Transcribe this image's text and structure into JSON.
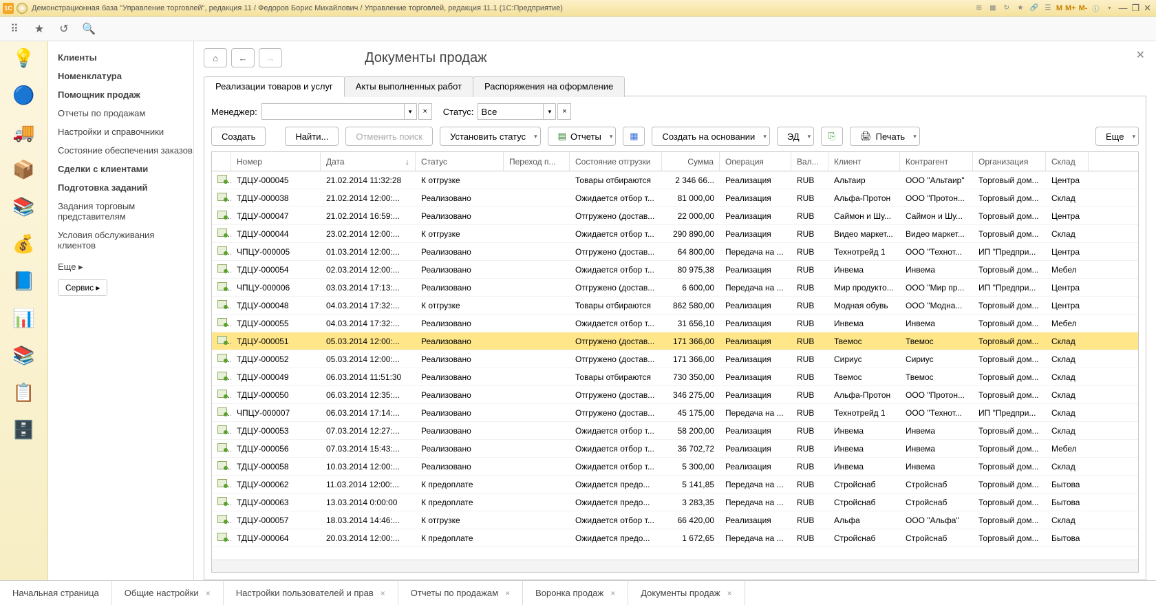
{
  "window_title": "Демонстрационная база \"Управление торговлей\", редакция 11 / Федоров Борис Михайлович / Управление торговлей, редакция 11.1  (1С:Предприятие)",
  "m_buttons": [
    "M",
    "M+",
    "M-"
  ],
  "nav": {
    "items": [
      {
        "label": "Клиенты",
        "bold": true
      },
      {
        "label": "Номенклатура",
        "bold": true
      },
      {
        "label": "Помощник продаж",
        "bold": true
      },
      {
        "label": "Отчеты по продажам",
        "bold": false
      },
      {
        "label": "Настройки и справочники",
        "bold": false
      },
      {
        "label": "Состояние обеспечения заказов",
        "bold": false
      },
      {
        "label": "Сделки с клиентами",
        "bold": true
      },
      {
        "label": "Подготовка заданий",
        "bold": true
      },
      {
        "label": "Задания торговым представителям",
        "bold": false
      },
      {
        "label": "Условия обслуживания клиентов",
        "bold": false
      }
    ],
    "more": "Еще ▸",
    "service": "Сервис ▸"
  },
  "page": {
    "title": "Документы продаж",
    "tabs": [
      "Реализации товаров и услуг",
      "Акты выполненных работ",
      "Распоряжения на оформление"
    ],
    "active_tab": 0,
    "filters": {
      "manager_label": "Менеджер:",
      "manager_value": "",
      "status_label": "Статус:",
      "status_value": "Все"
    },
    "actions": {
      "create": "Создать",
      "find": "Найти...",
      "cancel_search": "Отменить поиск",
      "set_status": "Установить статус",
      "reports": "Отчеты",
      "create_based": "Создать на основании",
      "ed": "ЭД",
      "print": "Печать",
      "more": "Еще"
    },
    "columns": [
      "Номер",
      "Дата",
      "Статус",
      "Переход п...",
      "Состояние отгрузки",
      "Сумма",
      "Операция",
      "Вал...",
      "Клиент",
      "Контрагент",
      "Организация",
      "Склад"
    ],
    "selected_row": 9,
    "rows": [
      {
        "num": "ТДЦУ-000045",
        "date": "21.02.2014 11:32:28",
        "status": "К отгрузке",
        "ship": "Товары отбираются",
        "sum": "2 346 66...",
        "op": "Реализация",
        "cur": "RUB",
        "client": "Альтаир",
        "contr": "ООО \"Альтаир\"",
        "org": "Торговый дом...",
        "store": "Центра"
      },
      {
        "num": "ТДЦУ-000038",
        "date": "21.02.2014 12:00:...",
        "status": "Реализовано",
        "ship": "Ожидается отбор т...",
        "sum": "81 000,00",
        "op": "Реализация",
        "cur": "RUB",
        "client": "Альфа-Протон",
        "contr": "ООО \"Протон...",
        "org": "Торговый дом...",
        "store": "Склад"
      },
      {
        "num": "ТДЦУ-000047",
        "date": "21.02.2014 16:59:...",
        "status": "Реализовано",
        "ship": "Отгружено (достав...",
        "sum": "22 000,00",
        "op": "Реализация",
        "cur": "RUB",
        "client": "Саймон и Шу...",
        "contr": "Саймон и Шу...",
        "org": "Торговый дом...",
        "store": "Центра"
      },
      {
        "num": "ТДЦУ-000044",
        "date": "23.02.2014 12:00:...",
        "status": "К отгрузке",
        "ship": "Ожидается отбор т...",
        "sum": "290 890,00",
        "op": "Реализация",
        "cur": "RUB",
        "client": "Видео маркет...",
        "contr": "Видео маркет...",
        "org": "Торговый дом...",
        "store": "Склад"
      },
      {
        "num": "ЧПЦУ-000005",
        "date": "01.03.2014 12:00:...",
        "status": "Реализовано",
        "ship": "Отгружено (достав...",
        "sum": "64 800,00",
        "op": "Передача на ...",
        "cur": "RUB",
        "client": "Технотрейд 1",
        "contr": "ООО \"Технот...",
        "org": "ИП \"Предпри...",
        "store": "Центра"
      },
      {
        "num": "ТДЦУ-000054",
        "date": "02.03.2014 12:00:...",
        "status": "Реализовано",
        "ship": "Ожидается отбор т...",
        "sum": "80 975,38",
        "op": "Реализация",
        "cur": "RUB",
        "client": "Инвема",
        "contr": "Инвема",
        "org": "Торговый дом...",
        "store": "Мебел"
      },
      {
        "num": "ЧПЦУ-000006",
        "date": "03.03.2014 17:13:...",
        "status": "Реализовано",
        "ship": "Отгружено (достав...",
        "sum": "6 600,00",
        "op": "Передача на ...",
        "cur": "RUB",
        "client": "Мир продукто...",
        "contr": "ООО \"Мир пр...",
        "org": "ИП \"Предпри...",
        "store": "Центра"
      },
      {
        "num": "ТДЦУ-000048",
        "date": "04.03.2014 17:32:...",
        "status": "К отгрузке",
        "ship": "Товары отбираются",
        "sum": "862 580,00",
        "op": "Реализация",
        "cur": "RUB",
        "client": "Модная обувь",
        "contr": "ООО \"Модна...",
        "org": "Торговый дом...",
        "store": "Центра"
      },
      {
        "num": "ТДЦУ-000055",
        "date": "04.03.2014 17:32:...",
        "status": "Реализовано",
        "ship": "Ожидается отбор т...",
        "sum": "31 656,10",
        "op": "Реализация",
        "cur": "RUB",
        "client": "Инвема",
        "contr": "Инвема",
        "org": "Торговый дом...",
        "store": "Мебел"
      },
      {
        "num": "ТДЦУ-000051",
        "date": "05.03.2014 12:00:...",
        "status": "Реализовано",
        "ship": "Отгружено (достав...",
        "sum": "171 366,00",
        "op": "Реализация",
        "cur": "RUB",
        "client": "Твемос",
        "contr": "Твемос",
        "org": "Торговый дом...",
        "store": "Склад"
      },
      {
        "num": "ТДЦУ-000052",
        "date": "05.03.2014 12:00:...",
        "status": "Реализовано",
        "ship": "Отгружено (достав...",
        "sum": "171 366,00",
        "op": "Реализация",
        "cur": "RUB",
        "client": "Сириус",
        "contr": "Сириус",
        "org": "Торговый дом...",
        "store": "Склад"
      },
      {
        "num": "ТДЦУ-000049",
        "date": "06.03.2014 11:51:30",
        "status": "Реализовано",
        "ship": "Товары отбираются",
        "sum": "730 350,00",
        "op": "Реализация",
        "cur": "RUB",
        "client": "Твемос",
        "contr": "Твемос",
        "org": "Торговый дом...",
        "store": "Склад"
      },
      {
        "num": "ТДЦУ-000050",
        "date": "06.03.2014 12:35:...",
        "status": "Реализовано",
        "ship": "Отгружено (достав...",
        "sum": "346 275,00",
        "op": "Реализация",
        "cur": "RUB",
        "client": "Альфа-Протон",
        "contr": "ООО \"Протон...",
        "org": "Торговый дом...",
        "store": "Склад"
      },
      {
        "num": "ЧПЦУ-000007",
        "date": "06.03.2014 17:14:...",
        "status": "Реализовано",
        "ship": "Отгружено (достав...",
        "sum": "45 175,00",
        "op": "Передача на ...",
        "cur": "RUB",
        "client": "Технотрейд 1",
        "contr": "ООО \"Технот...",
        "org": "ИП \"Предпри...",
        "store": "Склад"
      },
      {
        "num": "ТДЦУ-000053",
        "date": "07.03.2014 12:27:...",
        "status": "Реализовано",
        "ship": "Ожидается отбор т...",
        "sum": "58 200,00",
        "op": "Реализация",
        "cur": "RUB",
        "client": "Инвема",
        "contr": "Инвема",
        "org": "Торговый дом...",
        "store": "Склад"
      },
      {
        "num": "ТДЦУ-000056",
        "date": "07.03.2014 15:43:...",
        "status": "Реализовано",
        "ship": "Ожидается отбор т...",
        "sum": "36 702,72",
        "op": "Реализация",
        "cur": "RUB",
        "client": "Инвема",
        "contr": "Инвема",
        "org": "Торговый дом...",
        "store": "Мебел"
      },
      {
        "num": "ТДЦУ-000058",
        "date": "10.03.2014 12:00:...",
        "status": "Реализовано",
        "ship": "Ожидается отбор т...",
        "sum": "5 300,00",
        "op": "Реализация",
        "cur": "RUB",
        "client": "Инвема",
        "contr": "Инвема",
        "org": "Торговый дом...",
        "store": "Склад"
      },
      {
        "num": "ТДЦУ-000062",
        "date": "11.03.2014 12:00:...",
        "status": "К предоплате",
        "ship": "Ожидается предо...",
        "sum": "5 141,85",
        "op": "Передача на ...",
        "cur": "RUB",
        "client": "Стройснаб",
        "contr": "Стройснаб",
        "org": "Торговый дом...",
        "store": "Бытова"
      },
      {
        "num": "ТДЦУ-000063",
        "date": "13.03.2014 0:00:00",
        "status": "К предоплате",
        "ship": "Ожидается предо...",
        "sum": "3 283,35",
        "op": "Передача на ...",
        "cur": "RUB",
        "client": "Стройснаб",
        "contr": "Стройснаб",
        "org": "Торговый дом...",
        "store": "Бытова"
      },
      {
        "num": "ТДЦУ-000057",
        "date": "18.03.2014 14:46:...",
        "status": "К отгрузке",
        "ship": "Ожидается отбор т...",
        "sum": "66 420,00",
        "op": "Реализация",
        "cur": "RUB",
        "client": "Альфа",
        "contr": "ООО \"Альфа\"",
        "org": "Торговый дом...",
        "store": "Склад"
      },
      {
        "num": "ТДЦУ-000064",
        "date": "20.03.2014 12:00:...",
        "status": "К предоплате",
        "ship": "Ожидается предо...",
        "sum": "1 672,65",
        "op": "Передача на ...",
        "cur": "RUB",
        "client": "Стройснаб",
        "contr": "Стройснаб",
        "org": "Торговый дом...",
        "store": "Бытова"
      }
    ]
  },
  "bottom_tabs": [
    "Начальная страница",
    "Общие настройки",
    "Настройки пользователей и прав",
    "Отчеты по продажам",
    "Воронка продаж",
    "Документы продаж"
  ],
  "rail_icons": [
    "💡",
    "🔵",
    "🚚",
    "📦",
    "📚",
    "💰",
    "📘",
    "📊",
    "📚",
    "📋",
    "🗄️"
  ]
}
